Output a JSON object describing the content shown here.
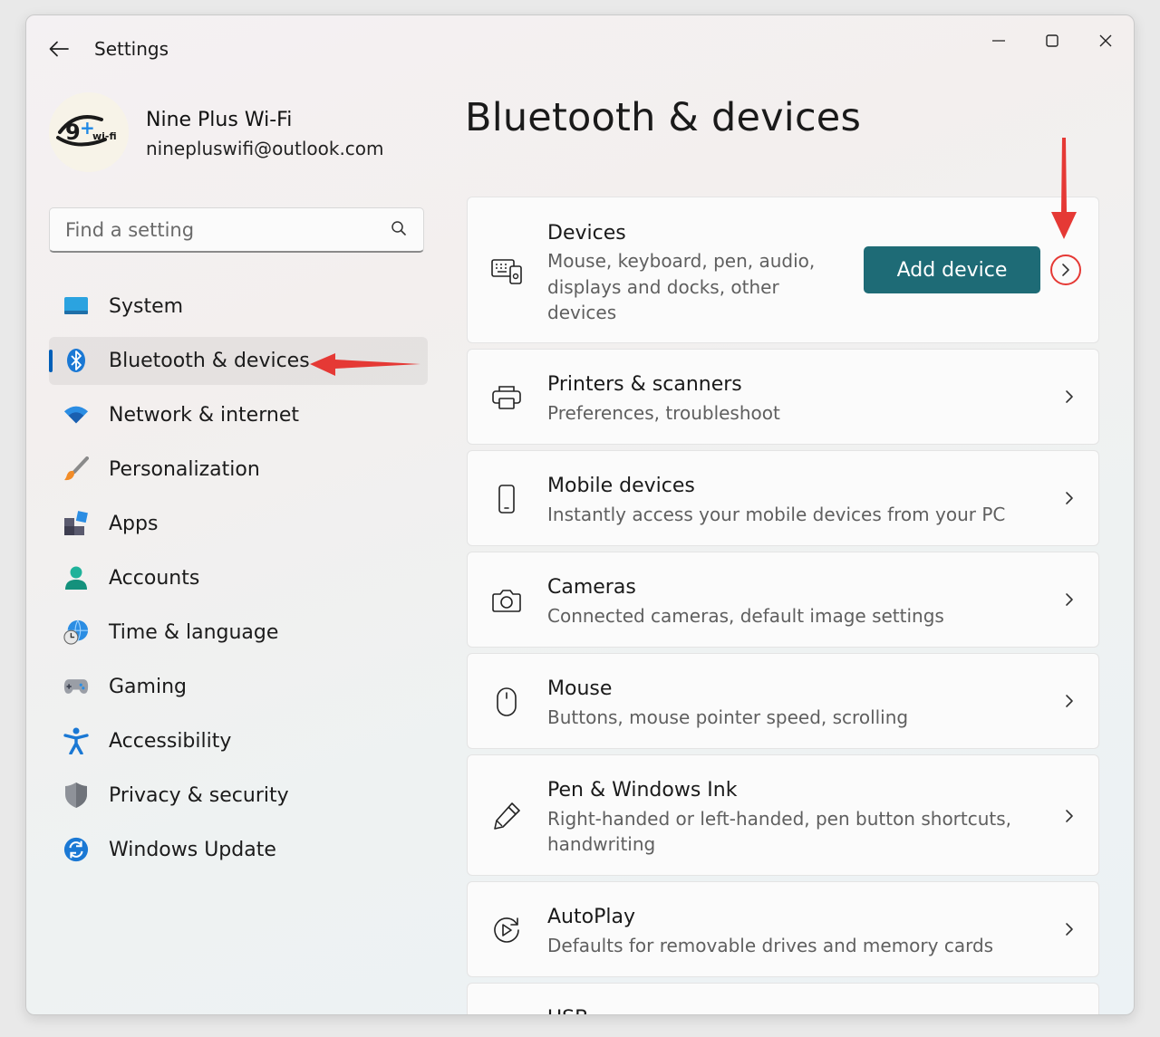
{
  "app": {
    "title": "Settings"
  },
  "profile": {
    "name": "Nine Plus Wi-Fi",
    "email": "ninepluswifi@outlook.com",
    "logo_text": "9+ wi-fi"
  },
  "search": {
    "placeholder": "Find a setting",
    "icon": "search-icon"
  },
  "sidebar": {
    "items": [
      {
        "label": "System",
        "icon": "system-icon",
        "active": false
      },
      {
        "label": "Bluetooth & devices",
        "icon": "bluetooth-icon",
        "active": true
      },
      {
        "label": "Network & internet",
        "icon": "wifi-icon",
        "active": false
      },
      {
        "label": "Personalization",
        "icon": "brush-icon",
        "active": false
      },
      {
        "label": "Apps",
        "icon": "apps-icon",
        "active": false
      },
      {
        "label": "Accounts",
        "icon": "person-icon",
        "active": false
      },
      {
        "label": "Time & language",
        "icon": "globe-clock-icon",
        "active": false
      },
      {
        "label": "Gaming",
        "icon": "gamepad-icon",
        "active": false
      },
      {
        "label": "Accessibility",
        "icon": "accessibility-icon",
        "active": false
      },
      {
        "label": "Privacy & security",
        "icon": "shield-icon",
        "active": false
      },
      {
        "label": "Windows Update",
        "icon": "update-icon",
        "active": false
      }
    ]
  },
  "main": {
    "title": "Bluetooth & devices",
    "devices_card": {
      "title": "Devices",
      "desc_lines": [
        "Mouse, keyboard, pen, audio,",
        "displays and docks, other",
        "devices"
      ],
      "button": "Add device"
    },
    "cards": [
      {
        "title": "Printers & scanners",
        "desc_lines": [
          "Preferences, troubleshoot"
        ],
        "icon": "printer-icon"
      },
      {
        "title": "Mobile devices",
        "desc_lines": [
          "Instantly access your mobile devices from your PC"
        ],
        "icon": "phone-icon"
      },
      {
        "title": "Cameras",
        "desc_lines": [
          "Connected cameras, default image settings"
        ],
        "icon": "camera-icon"
      },
      {
        "title": "Mouse",
        "desc_lines": [
          "Buttons, mouse pointer speed, scrolling"
        ],
        "icon": "mouse-icon"
      },
      {
        "title": "Pen & Windows Ink",
        "desc_lines": [
          "Right-handed or left-handed, pen button shortcuts,",
          "handwriting"
        ],
        "icon": "pen-icon"
      },
      {
        "title": "AutoPlay",
        "desc_lines": [
          "Defaults for removable drives and memory cards"
        ],
        "icon": "autoplay-icon"
      },
      {
        "title": "USB",
        "desc_lines": [],
        "icon": "usb-icon"
      }
    ]
  },
  "colors": {
    "accent": "#1e6b76",
    "annotation": "#e53935",
    "selection_pill": "#005fb8"
  }
}
